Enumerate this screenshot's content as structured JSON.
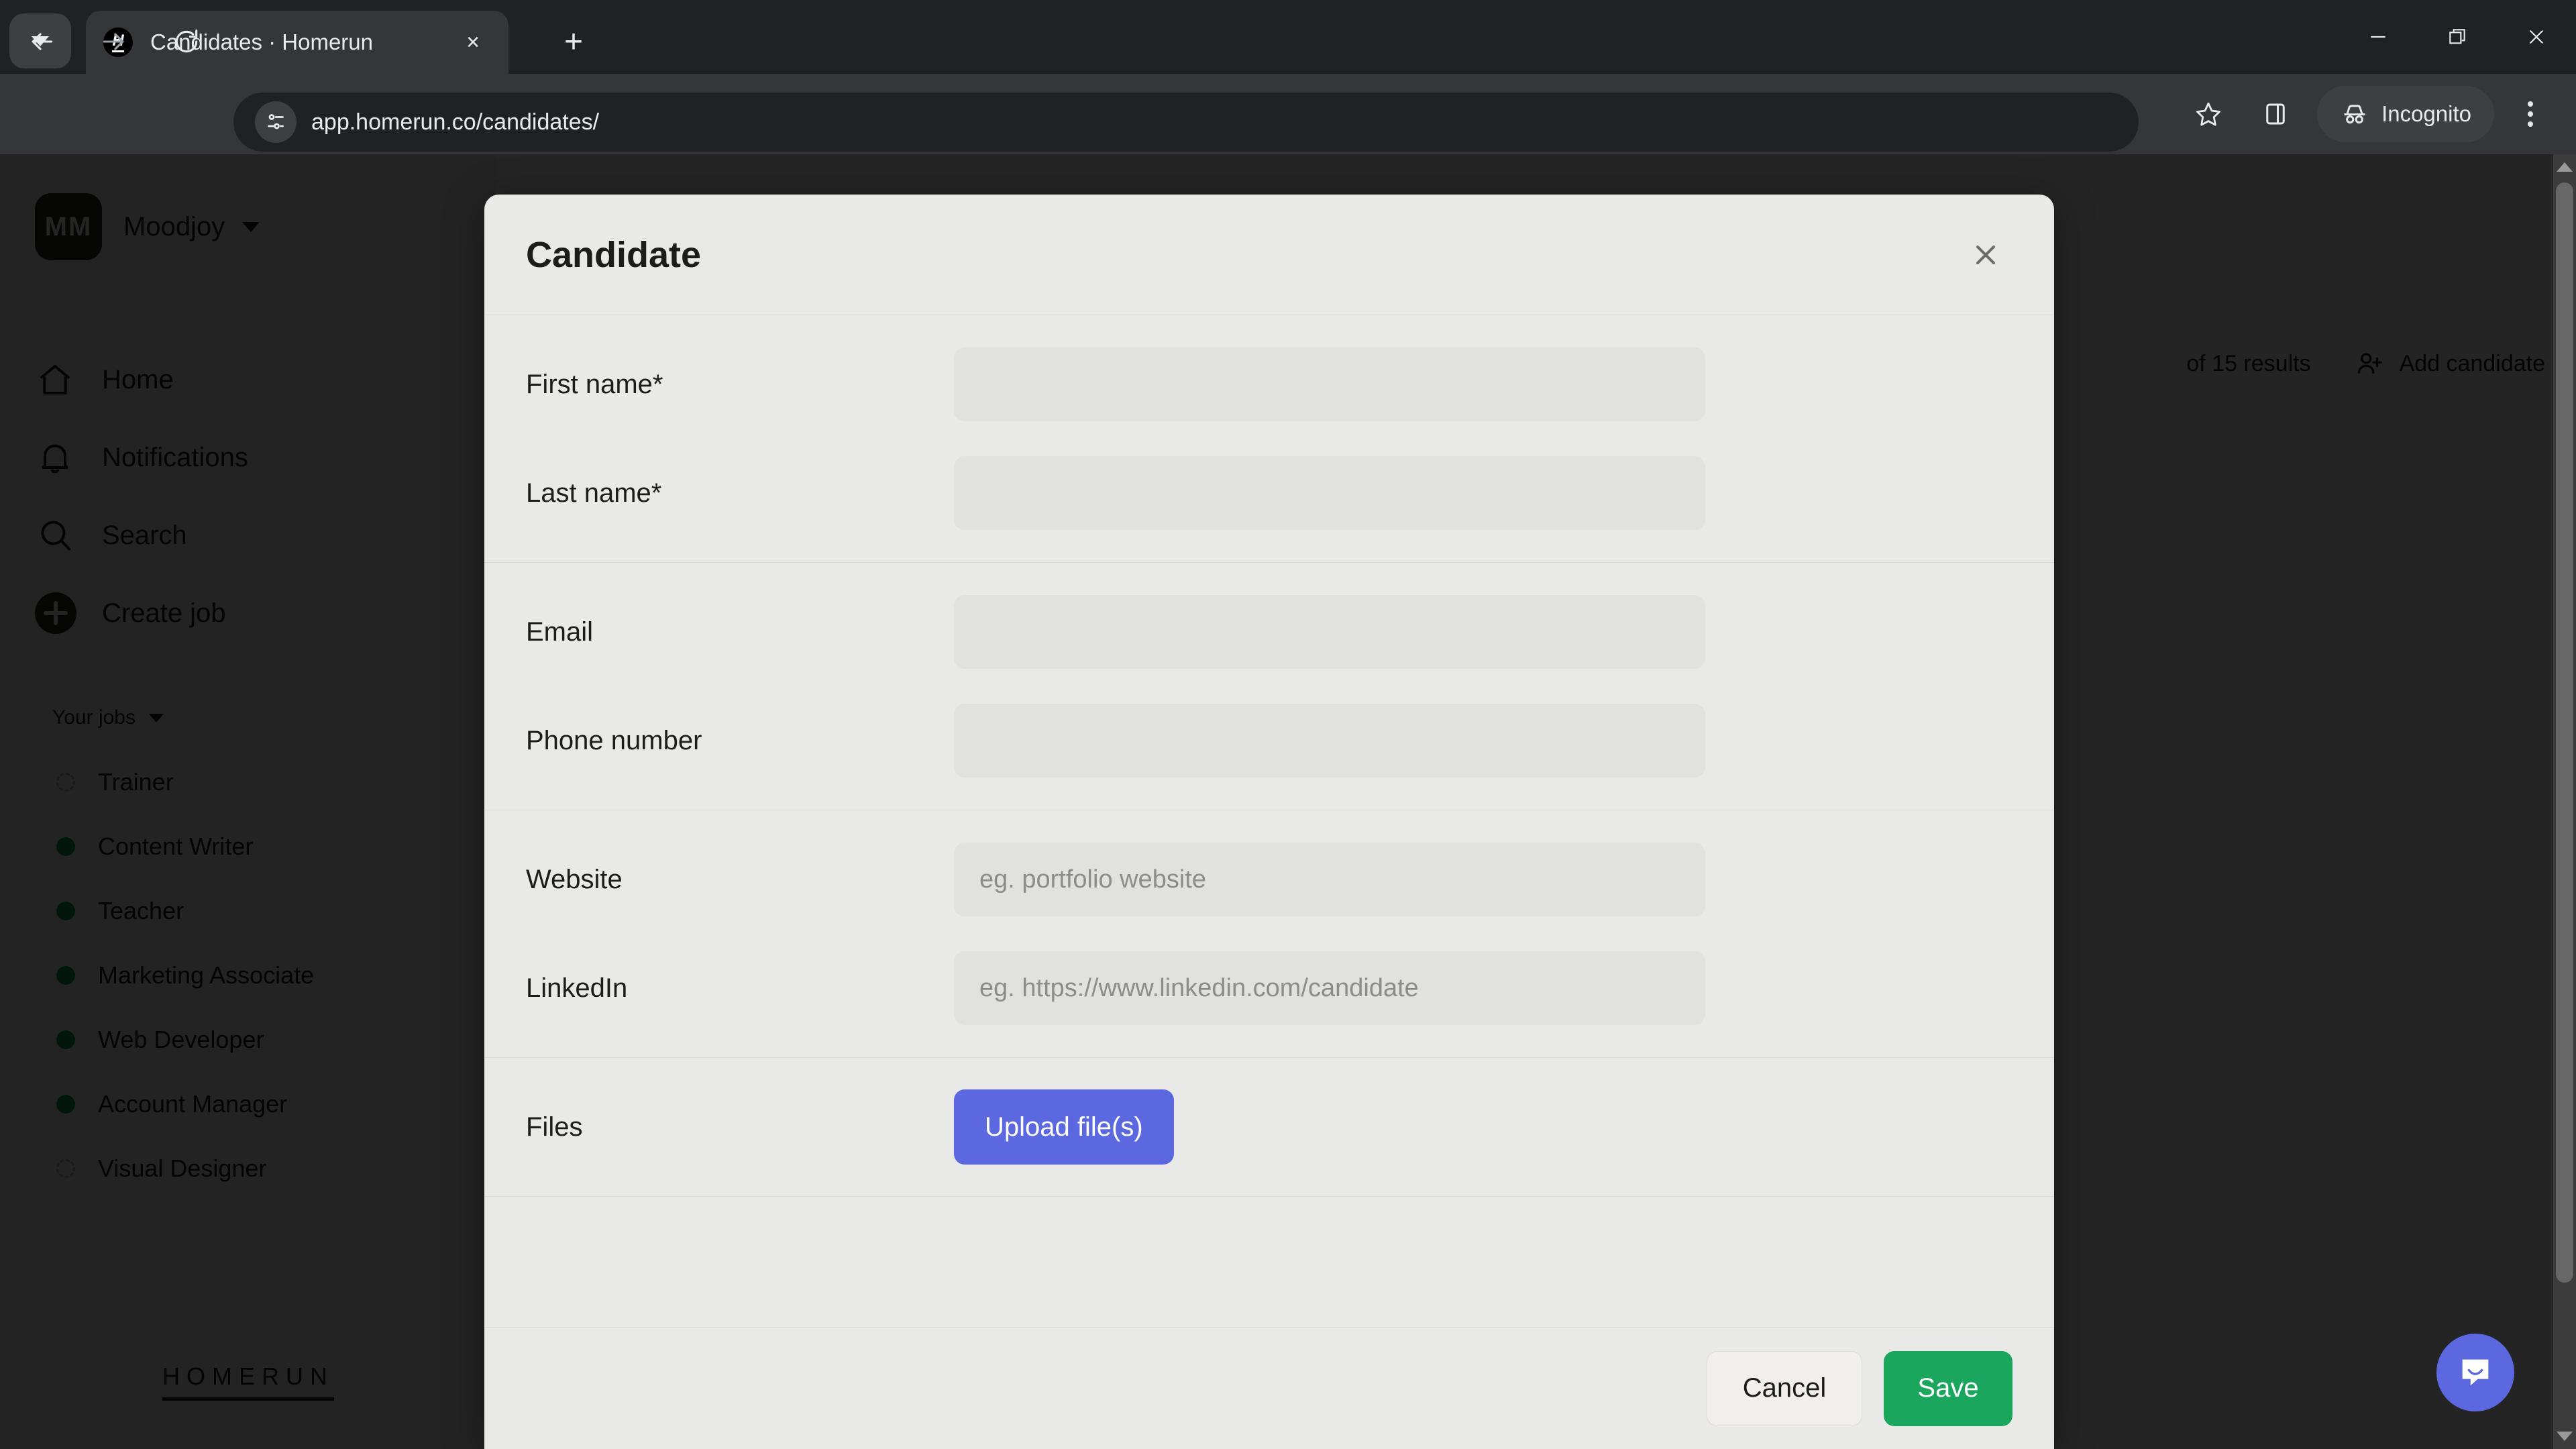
{
  "browser": {
    "tab": {
      "title": "Candidates · Homerun",
      "favicon_letter": "H",
      "close_label": "×"
    },
    "new_tab_label": "+",
    "url": "app.homerun.co/candidates/",
    "incognito_label": "Incognito",
    "window_controls": {
      "minimize": "minimize-icon",
      "maximize": "restore-icon",
      "close": "close-icon"
    },
    "icons": {
      "tab_list": "chevron-down-icon",
      "back": "back-arrow-icon",
      "forward": "forward-arrow-icon",
      "reload": "reload-icon",
      "site_info": "site-settings-icon",
      "bookmark": "star-icon",
      "side_panel": "side-panel-icon",
      "incognito": "incognito-hat-icon",
      "menu": "three-dots-menu-icon"
    }
  },
  "sidebar": {
    "org": {
      "initials": "MM",
      "name": "Moodjoy"
    },
    "nav": [
      {
        "label": "Home",
        "icon": "home-icon"
      },
      {
        "label": "Notifications",
        "icon": "bell-icon"
      },
      {
        "label": "Search",
        "icon": "search-icon"
      },
      {
        "label": "Create job",
        "icon": "plus-circle-icon"
      }
    ],
    "jobs_header": "Your jobs",
    "jobs": [
      {
        "title": "Trainer",
        "status": "draft"
      },
      {
        "title": "Content Writer",
        "status": "open"
      },
      {
        "title": "Teacher",
        "status": "open"
      },
      {
        "title": "Marketing Associate",
        "status": "open"
      },
      {
        "title": "Web Developer",
        "status": "open"
      },
      {
        "title": "Account Manager",
        "status": "open"
      },
      {
        "title": "Visual Designer",
        "status": "draft"
      }
    ],
    "brand": "HOMERUN"
  },
  "content": {
    "results_text": "of 15 results",
    "add_candidate_label": "Add candidate",
    "add_candidate_icon": "add-person-icon",
    "intercom_icon": "chat-bubble-icon"
  },
  "modal": {
    "title": "Candidate",
    "close_icon": "close-icon",
    "sections": [
      {
        "fields": [
          {
            "label": "First name*",
            "value": "",
            "placeholder": ""
          },
          {
            "label": "Last name*",
            "value": "",
            "placeholder": ""
          }
        ]
      },
      {
        "fields": [
          {
            "label": "Email",
            "value": "",
            "placeholder": ""
          },
          {
            "label": "Phone number",
            "value": "",
            "placeholder": ""
          }
        ]
      },
      {
        "fields": [
          {
            "label": "Website",
            "value": "",
            "placeholder": "eg. portfolio website"
          },
          {
            "label": "LinkedIn",
            "value": "",
            "placeholder": "eg. https://www.linkedin.com/candidate"
          }
        ]
      }
    ],
    "files": {
      "label": "Files",
      "upload_label": "Upload file(s)"
    },
    "footer": {
      "cancel_label": "Cancel",
      "save_label": "Save"
    }
  },
  "colors": {
    "accent_blue": "#5b68df",
    "save_green": "#1aa65c",
    "job_open_dot": "#1a9c53",
    "modal_bg": "#e9e9e7",
    "input_bg": "#e1e1dd"
  }
}
